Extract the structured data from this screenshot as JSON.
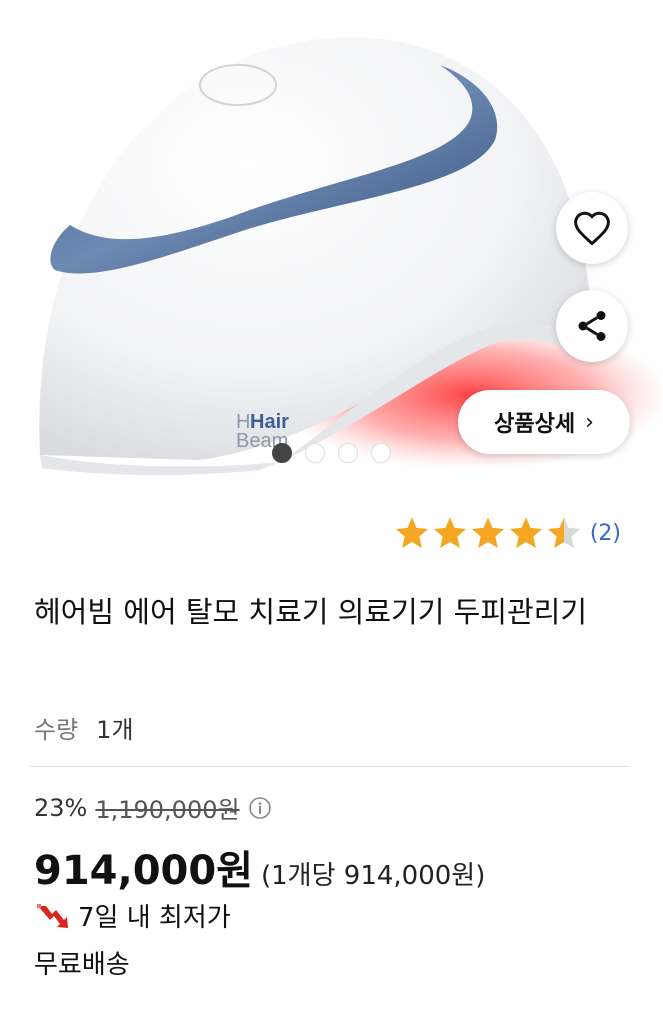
{
  "product": {
    "logo_text_1": "Hair",
    "logo_text_2": "Beam",
    "detail_button": "상품상세",
    "detail_chevron": "›",
    "icons": {
      "wish": "heart-icon",
      "share": "share-icon",
      "info": "info-icon",
      "trend": "arrow-down-icon"
    },
    "slides_total": 4,
    "slide_active": 1
  },
  "rating": {
    "score": 4.5,
    "max": 5,
    "count": "(2)",
    "star_color": "#f5a623"
  },
  "title": "헤어빔 에어 탈모 치료기 의료기기 두피관리기",
  "quantity": {
    "label": "수량",
    "value": "1개"
  },
  "price": {
    "discount": "23%",
    "original": "1,190,000원",
    "final": "914,000",
    "currency": "원",
    "unit_price": "(1개당 914,000원)",
    "lowest_badge": "7일 내 최저가",
    "shipping": "무료배송"
  }
}
